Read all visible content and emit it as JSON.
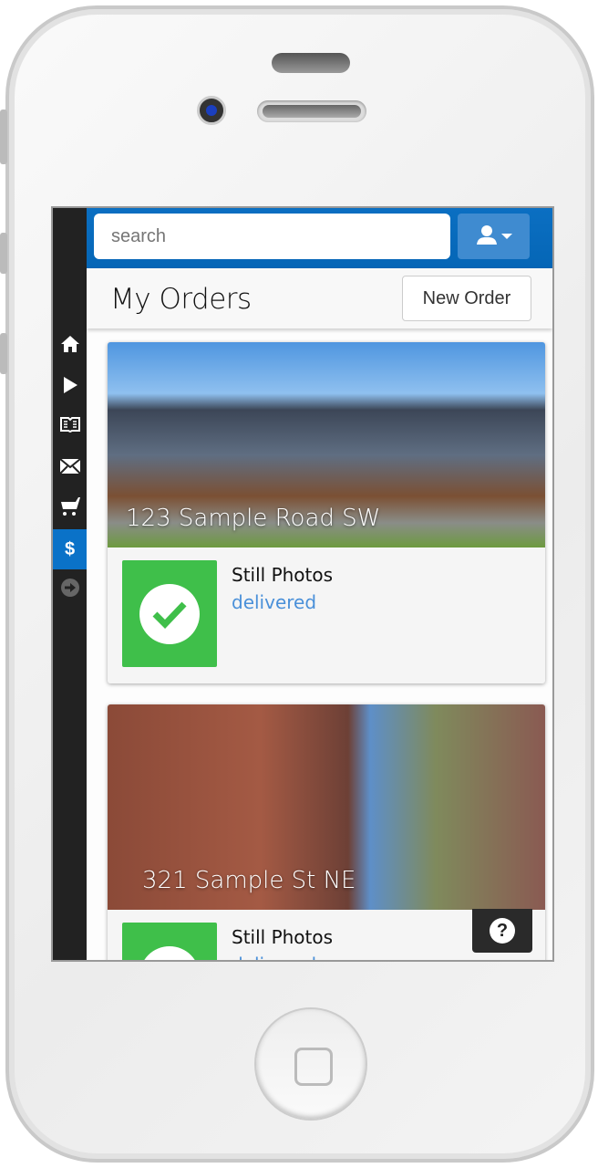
{
  "search": {
    "placeholder": "search"
  },
  "header": {
    "title": "My Orders",
    "new_order_label": "New Order"
  },
  "sidebar": {
    "items": [
      {
        "icon": "home-icon",
        "glyph": "⌂"
      },
      {
        "icon": "play-icon",
        "glyph": "▶"
      },
      {
        "icon": "book-icon",
        "glyph": "📖"
      },
      {
        "icon": "mail-icon",
        "glyph": "✉"
      },
      {
        "icon": "cart-icon",
        "glyph": "🛒"
      },
      {
        "icon": "dollar-icon",
        "glyph": "$",
        "active": true
      },
      {
        "icon": "arrow-right-circle-icon",
        "glyph": "➔"
      }
    ]
  },
  "orders": [
    {
      "address": "123 Sample Road SW",
      "service": "Still Photos",
      "status": "delivered"
    },
    {
      "address": "321 Sample St NE",
      "service": "Still Photos",
      "status": "delivered"
    }
  ],
  "help": {
    "glyph": "?"
  },
  "colors": {
    "accent": "#0a72c8",
    "delivered": "#3fbf4a",
    "status_text": "#4a90d9"
  }
}
